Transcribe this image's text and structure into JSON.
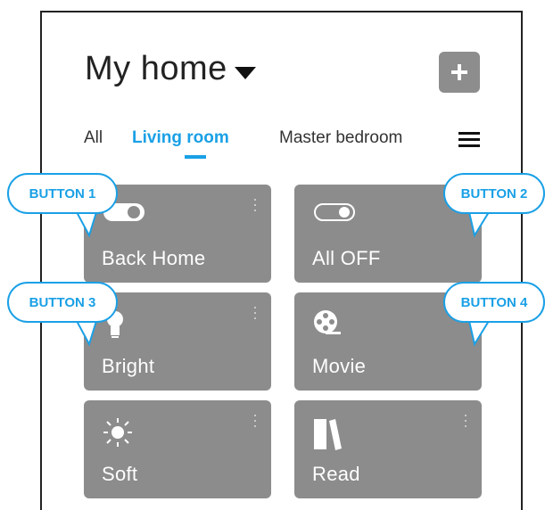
{
  "header": {
    "title": "My home"
  },
  "tabs": [
    {
      "label": "All"
    },
    {
      "label": "Living room"
    },
    {
      "label": "Master bedroom"
    }
  ],
  "active_tab": "Living room",
  "tiles": [
    {
      "label": "Back Home",
      "icon": "toggle-icon"
    },
    {
      "label": "All OFF",
      "icon": "toggle-outline-icon"
    },
    {
      "label": "Bright",
      "icon": "bulb-icon"
    },
    {
      "label": "Movie",
      "icon": "film-reel-icon"
    },
    {
      "label": "Soft",
      "icon": "sun-icon"
    },
    {
      "label": "Read",
      "icon": "book-icon"
    }
  ],
  "callouts": [
    {
      "label": "BUTTON 1"
    },
    {
      "label": "BUTTON 2"
    },
    {
      "label": "BUTTON 3"
    },
    {
      "label": "BUTTON 4"
    }
  ],
  "colors": {
    "accent": "#1aa0e6",
    "tile": "#8c8c8c",
    "add_button": "#8d8d8d"
  }
}
